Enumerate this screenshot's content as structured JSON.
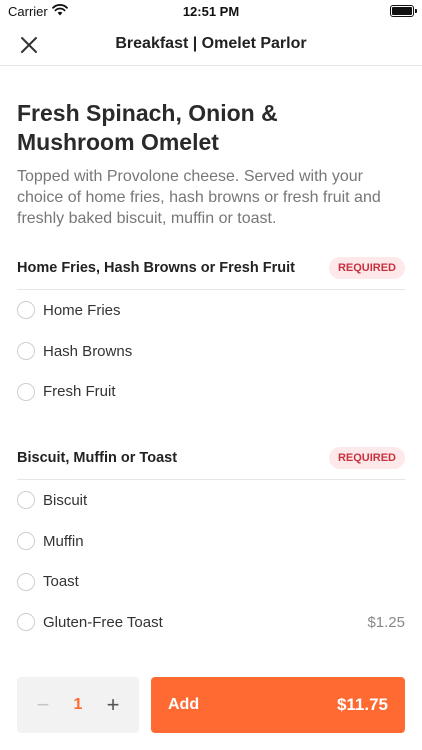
{
  "status_bar": {
    "carrier": "Carrier",
    "time": "12:51 PM"
  },
  "nav": {
    "title": "Breakfast | Omelet Parlor"
  },
  "item": {
    "title": "Fresh Spinach, Onion & Mushroom Omelet",
    "description": "Topped with Provolone cheese. Served with your choice of home fries, hash browns or fresh fruit and freshly baked biscuit, muffin or toast."
  },
  "groups": [
    {
      "title": "Home Fries, Hash Browns or Fresh Fruit",
      "badge": "REQUIRED",
      "options": [
        {
          "label": "Home Fries",
          "price": ""
        },
        {
          "label": "Hash Browns",
          "price": ""
        },
        {
          "label": "Fresh Fruit",
          "price": ""
        }
      ]
    },
    {
      "title": "Biscuit, Muffin or Toast",
      "badge": "REQUIRED",
      "options": [
        {
          "label": "Biscuit",
          "price": ""
        },
        {
          "label": "Muffin",
          "price": ""
        },
        {
          "label": "Toast",
          "price": ""
        },
        {
          "label": "Gluten-Free Toast",
          "price": "$1.25"
        }
      ]
    }
  ],
  "footer": {
    "quantity": "1",
    "minus_symbol": "−",
    "plus_symbol": "+",
    "add_label": "Add",
    "add_price": "$11.75"
  },
  "colors": {
    "accent": "#ff6a33",
    "badge_bg": "#fde8ea",
    "badge_text": "#c8323e"
  }
}
